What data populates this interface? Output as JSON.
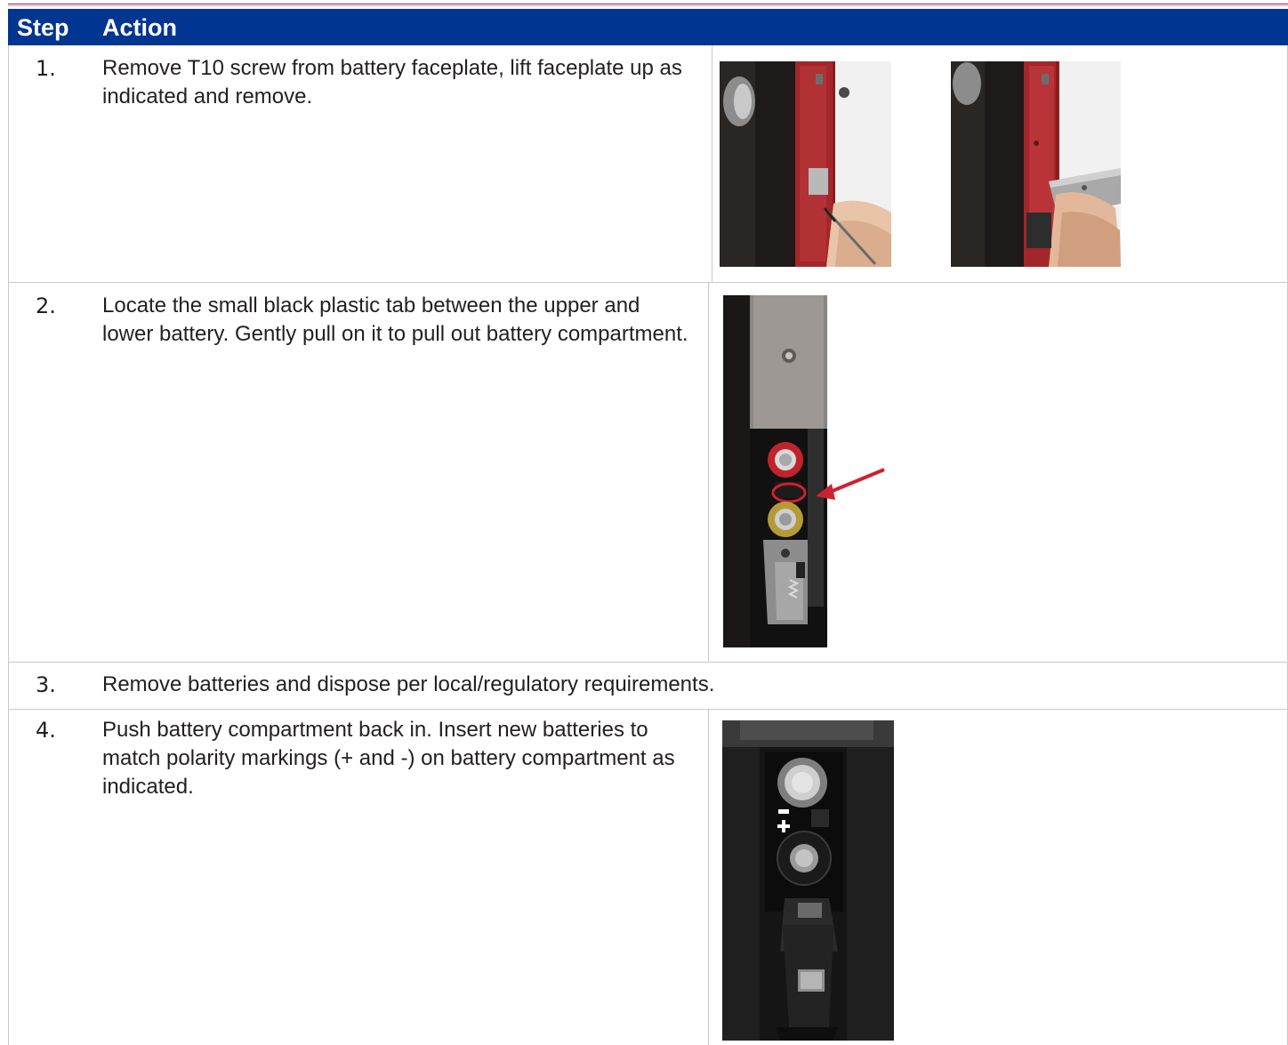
{
  "header": {
    "step_label": "Step",
    "action_label": "Action"
  },
  "steps": [
    {
      "number": "1.",
      "action": "Remove T10 screw from battery faceplate, lift faceplate up as indicated and remove."
    },
    {
      "number": "2.",
      "action": "Locate the small black plastic tab between the upper and lower battery. Gently pull on it to pull out battery compartment."
    },
    {
      "number": "3.",
      "action": "Remove batteries and dispose per local/regulatory requirements."
    },
    {
      "number": "4.",
      "action": "Push battery compartment back in. Insert new batteries to match polarity markings (+ and -) on battery compartment as indicated."
    }
  ],
  "colors": {
    "header_bg": "#003591",
    "header_text": "#ffffff",
    "accent_rule": "#c8102e",
    "grid": "#c9c9c9",
    "callout": "#d0212e"
  },
  "images": [
    {
      "step": 1,
      "subject": "screwdriver removing screw from faceplate"
    },
    {
      "step": 1,
      "subject": "hand lifting faceplate off"
    },
    {
      "step": 2,
      "subject": "battery compartment with tab circled and arrow"
    },
    {
      "step": 4,
      "subject": "battery compartment with polarity markings"
    }
  ]
}
